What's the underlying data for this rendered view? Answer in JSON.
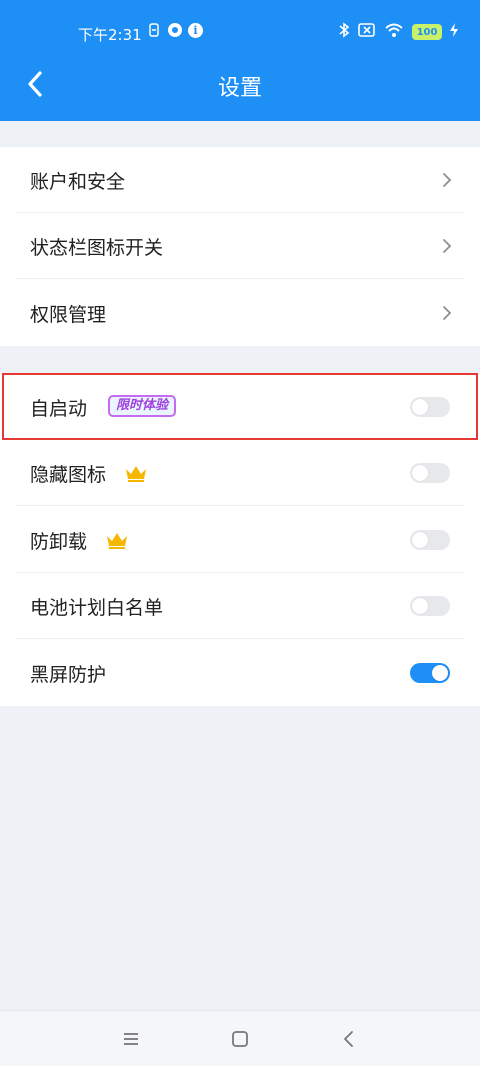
{
  "status_bar": {
    "time": "下午2:31",
    "battery": "100"
  },
  "header": {
    "title": "设置"
  },
  "section1": {
    "items": [
      {
        "label": "账户和安全"
      },
      {
        "label": "状态栏图标开关"
      },
      {
        "label": "权限管理"
      }
    ]
  },
  "section2": {
    "items": [
      {
        "label": "自启动",
        "badge": "限时体验",
        "enabled": false
      },
      {
        "label": "隐藏图标",
        "premium": true,
        "enabled": false
      },
      {
        "label": "防卸载",
        "premium": true,
        "enabled": false
      },
      {
        "label": "电池计划白名单",
        "enabled": false
      },
      {
        "label": "黑屏防护",
        "enabled": true
      }
    ]
  },
  "colors": {
    "primary": "#1e8ff5",
    "highlight_border": "#e53935",
    "crown": "#f5b800",
    "badge_text": "#a243e0"
  },
  "icons": {
    "back": "chevron-left-icon",
    "chevron": "chevron-right-icon",
    "crown": "crown-icon",
    "nav_menu": "menu-icon",
    "nav_home": "square-icon",
    "nav_back": "triangle-back-icon"
  }
}
